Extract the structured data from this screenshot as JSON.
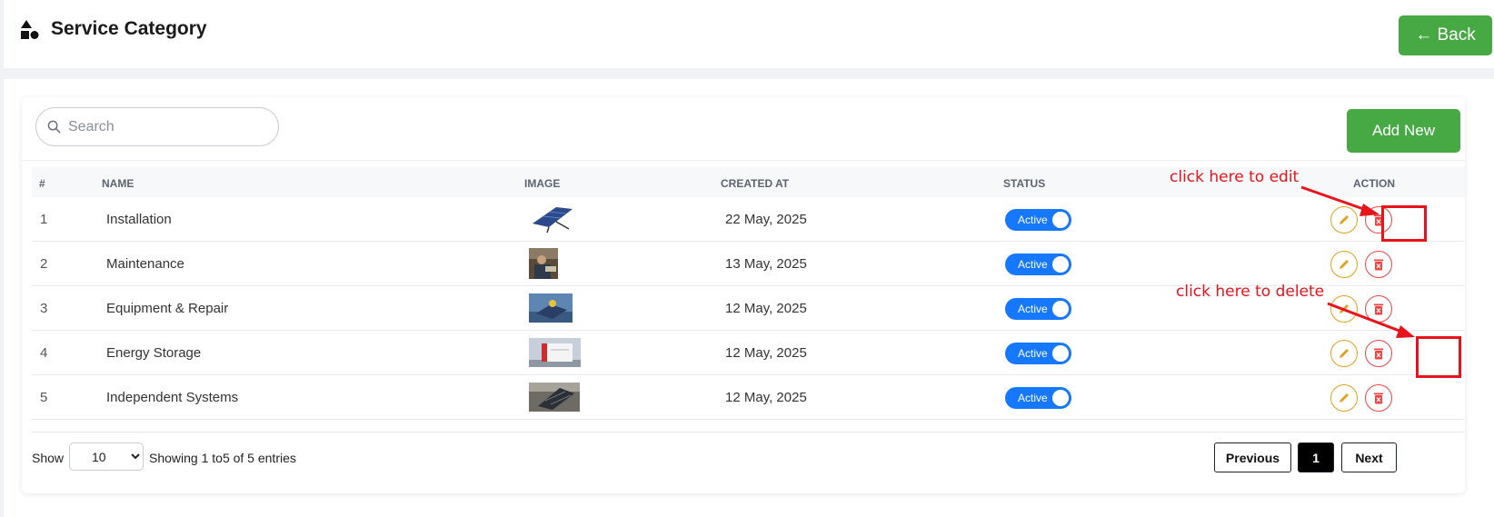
{
  "header": {
    "title": "Service Category",
    "back_label": "← Back"
  },
  "toolbar": {
    "search_placeholder": "Search",
    "add_label": "Add New"
  },
  "table": {
    "columns": {
      "num": "#",
      "name": "NAME",
      "image": "IMAGE",
      "created": "CREATED AT",
      "status": "STATUS",
      "action": "ACTION"
    },
    "rows": [
      {
        "num": "1",
        "name": "Installation",
        "created": "22 May, 2025",
        "status": "Active"
      },
      {
        "num": "2",
        "name": "Maintenance",
        "created": "13 May, 2025",
        "status": "Active"
      },
      {
        "num": "3",
        "name": "Equipment & Repair",
        "created": "12 May, 2025",
        "status": "Active"
      },
      {
        "num": "4",
        "name": "Energy Storage",
        "created": "12 May, 2025",
        "status": "Active"
      },
      {
        "num": "5",
        "name": "Independent Systems",
        "created": "12 May, 2025",
        "status": "Active"
      }
    ]
  },
  "footer": {
    "show_label": "Show",
    "page_size": "10",
    "entries_text": "Showing 1  to5  of 5 entries",
    "prev_label": "Previous",
    "current_page": "1",
    "next_label": "Next"
  },
  "annotations": {
    "edit_hint": "click here to edit",
    "delete_hint": "click here to delete"
  },
  "colors": {
    "primary_green": "#47a944",
    "toggle_blue": "#1677ff",
    "edit_orange": "#e0a11d",
    "delete_red": "#ef4444",
    "annotation_red": "#e8131b"
  }
}
